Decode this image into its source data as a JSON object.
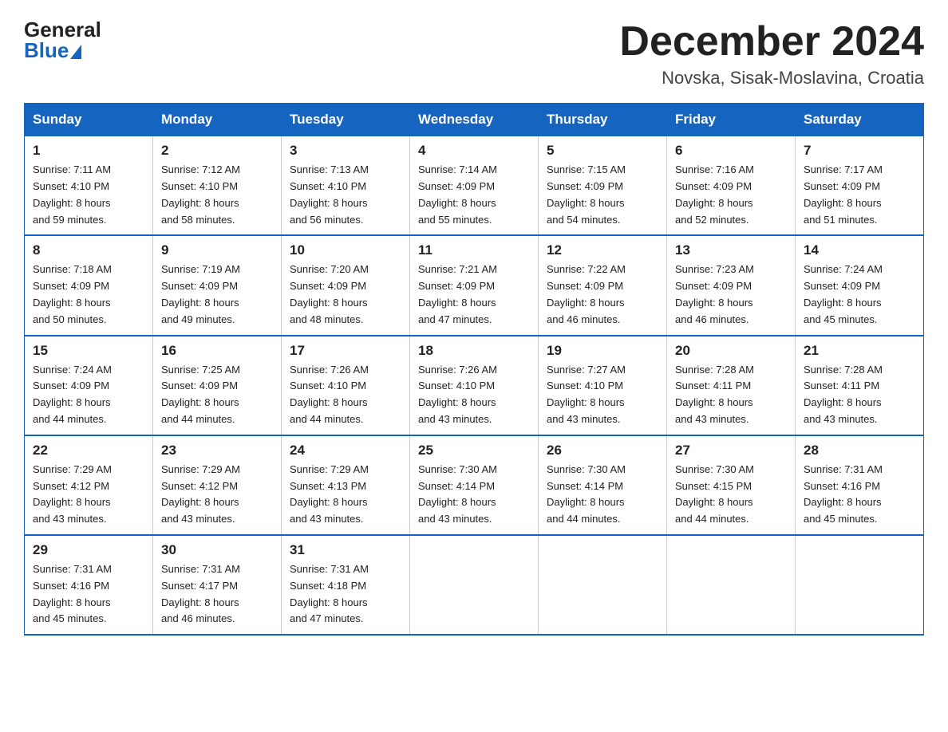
{
  "logo": {
    "general": "General",
    "blue": "Blue"
  },
  "header": {
    "month": "December 2024",
    "location": "Novska, Sisak-Moslavina, Croatia"
  },
  "days_of_week": [
    "Sunday",
    "Monday",
    "Tuesday",
    "Wednesday",
    "Thursday",
    "Friday",
    "Saturday"
  ],
  "weeks": [
    [
      {
        "day": "1",
        "sunrise": "7:11 AM",
        "sunset": "4:10 PM",
        "daylight": "8 hours and 59 minutes."
      },
      {
        "day": "2",
        "sunrise": "7:12 AM",
        "sunset": "4:10 PM",
        "daylight": "8 hours and 58 minutes."
      },
      {
        "day": "3",
        "sunrise": "7:13 AM",
        "sunset": "4:10 PM",
        "daylight": "8 hours and 56 minutes."
      },
      {
        "day": "4",
        "sunrise": "7:14 AM",
        "sunset": "4:09 PM",
        "daylight": "8 hours and 55 minutes."
      },
      {
        "day": "5",
        "sunrise": "7:15 AM",
        "sunset": "4:09 PM",
        "daylight": "8 hours and 54 minutes."
      },
      {
        "day": "6",
        "sunrise": "7:16 AM",
        "sunset": "4:09 PM",
        "daylight": "8 hours and 52 minutes."
      },
      {
        "day": "7",
        "sunrise": "7:17 AM",
        "sunset": "4:09 PM",
        "daylight": "8 hours and 51 minutes."
      }
    ],
    [
      {
        "day": "8",
        "sunrise": "7:18 AM",
        "sunset": "4:09 PM",
        "daylight": "8 hours and 50 minutes."
      },
      {
        "day": "9",
        "sunrise": "7:19 AM",
        "sunset": "4:09 PM",
        "daylight": "8 hours and 49 minutes."
      },
      {
        "day": "10",
        "sunrise": "7:20 AM",
        "sunset": "4:09 PM",
        "daylight": "8 hours and 48 minutes."
      },
      {
        "day": "11",
        "sunrise": "7:21 AM",
        "sunset": "4:09 PM",
        "daylight": "8 hours and 47 minutes."
      },
      {
        "day": "12",
        "sunrise": "7:22 AM",
        "sunset": "4:09 PM",
        "daylight": "8 hours and 46 minutes."
      },
      {
        "day": "13",
        "sunrise": "7:23 AM",
        "sunset": "4:09 PM",
        "daylight": "8 hours and 46 minutes."
      },
      {
        "day": "14",
        "sunrise": "7:24 AM",
        "sunset": "4:09 PM",
        "daylight": "8 hours and 45 minutes."
      }
    ],
    [
      {
        "day": "15",
        "sunrise": "7:24 AM",
        "sunset": "4:09 PM",
        "daylight": "8 hours and 44 minutes."
      },
      {
        "day": "16",
        "sunrise": "7:25 AM",
        "sunset": "4:09 PM",
        "daylight": "8 hours and 44 minutes."
      },
      {
        "day": "17",
        "sunrise": "7:26 AM",
        "sunset": "4:10 PM",
        "daylight": "8 hours and 44 minutes."
      },
      {
        "day": "18",
        "sunrise": "7:26 AM",
        "sunset": "4:10 PM",
        "daylight": "8 hours and 43 minutes."
      },
      {
        "day": "19",
        "sunrise": "7:27 AM",
        "sunset": "4:10 PM",
        "daylight": "8 hours and 43 minutes."
      },
      {
        "day": "20",
        "sunrise": "7:28 AM",
        "sunset": "4:11 PM",
        "daylight": "8 hours and 43 minutes."
      },
      {
        "day": "21",
        "sunrise": "7:28 AM",
        "sunset": "4:11 PM",
        "daylight": "8 hours and 43 minutes."
      }
    ],
    [
      {
        "day": "22",
        "sunrise": "7:29 AM",
        "sunset": "4:12 PM",
        "daylight": "8 hours and 43 minutes."
      },
      {
        "day": "23",
        "sunrise": "7:29 AM",
        "sunset": "4:12 PM",
        "daylight": "8 hours and 43 minutes."
      },
      {
        "day": "24",
        "sunrise": "7:29 AM",
        "sunset": "4:13 PM",
        "daylight": "8 hours and 43 minutes."
      },
      {
        "day": "25",
        "sunrise": "7:30 AM",
        "sunset": "4:14 PM",
        "daylight": "8 hours and 43 minutes."
      },
      {
        "day": "26",
        "sunrise": "7:30 AM",
        "sunset": "4:14 PM",
        "daylight": "8 hours and 44 minutes."
      },
      {
        "day": "27",
        "sunrise": "7:30 AM",
        "sunset": "4:15 PM",
        "daylight": "8 hours and 44 minutes."
      },
      {
        "day": "28",
        "sunrise": "7:31 AM",
        "sunset": "4:16 PM",
        "daylight": "8 hours and 45 minutes."
      }
    ],
    [
      {
        "day": "29",
        "sunrise": "7:31 AM",
        "sunset": "4:16 PM",
        "daylight": "8 hours and 45 minutes."
      },
      {
        "day": "30",
        "sunrise": "7:31 AM",
        "sunset": "4:17 PM",
        "daylight": "8 hours and 46 minutes."
      },
      {
        "day": "31",
        "sunrise": "7:31 AM",
        "sunset": "4:18 PM",
        "daylight": "8 hours and 47 minutes."
      },
      null,
      null,
      null,
      null
    ]
  ],
  "labels": {
    "sunrise": "Sunrise:",
    "sunset": "Sunset:",
    "daylight": "Daylight:"
  }
}
